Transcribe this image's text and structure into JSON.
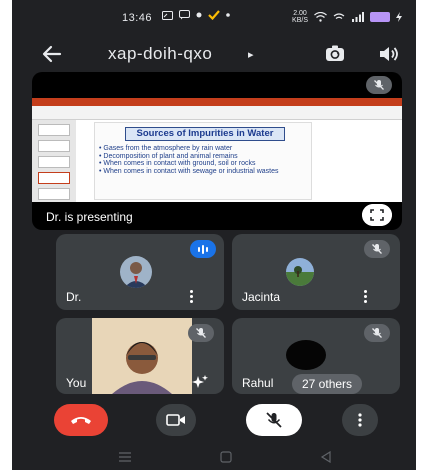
{
  "status_bar": {
    "time": "13:46",
    "network_speed_value": "2.00",
    "network_speed_unit": "KB/S"
  },
  "header": {
    "meeting_code": "xap-doih-qxo",
    "caret": "▸"
  },
  "presentation": {
    "slide_title": "Sources of Impurities in Water",
    "bullets": [
      "Gases from the atmosphere by rain water",
      "Decomposition of plant and animal remains",
      "When comes in contact with ground, soil or rocks",
      "When comes in contact with sewage or industrial wastes"
    ],
    "presenting_label": "Dr. is presenting"
  },
  "participants": [
    {
      "name": "Dr.",
      "status": "speaking"
    },
    {
      "name": "Jacinta",
      "status": "muted"
    },
    {
      "name": "You",
      "status": "muted"
    },
    {
      "name": "Rahul",
      "status": "muted",
      "others_label": "27 others"
    }
  ],
  "icons": {
    "back": "arrow-left-icon",
    "switch_camera": "switch-camera-icon",
    "audio_output": "speaker-icon",
    "mic_off": "mic-off-icon",
    "fullscreen": "fullscreen-icon",
    "end_call": "end-call-icon",
    "camera": "camera-icon",
    "more": "more-vert-icon"
  },
  "colors": {
    "background": "#202124",
    "tile": "#3c4043",
    "end_call": "#ea4335",
    "speaking": "#1a73e8",
    "slide_text": "#1f3f8a"
  }
}
